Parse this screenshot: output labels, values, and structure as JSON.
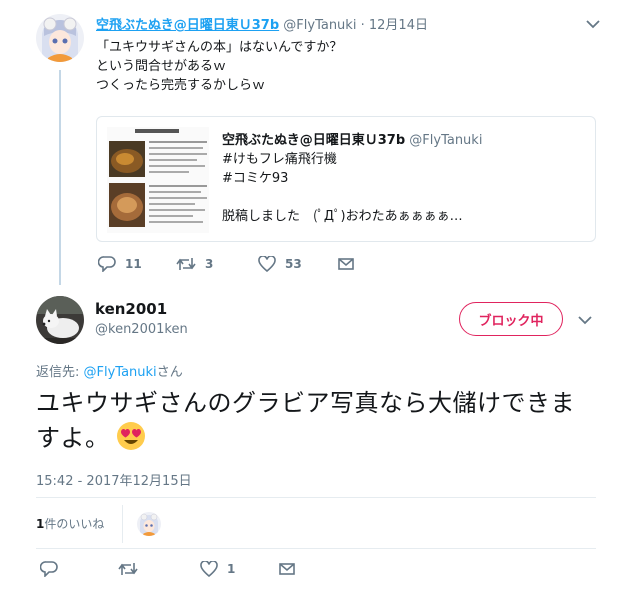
{
  "parent_tweet": {
    "name": "空飛ぶたぬき@日曜日東Ｕ37b",
    "handle": "@FlyTanuki",
    "separator": "·",
    "time": "12月14日",
    "lines": [
      "「ユキウサギさんの本」はないんですか？",
      "という問合せがあるｗ",
      "つくったら完売するかしらｗ"
    ],
    "quote": {
      "name": "空飛ぶたぬき@日曜日東Ｕ37b",
      "handle": "@FlyTanuki",
      "lines": [
        "#けもフレ痛飛行機",
        "#コミケ93",
        "",
        "脱稿しました　(ﾟДﾟ)おわたあぁぁぁぁ…"
      ]
    },
    "actions": {
      "replies": "11",
      "retweets": "3",
      "likes": "53"
    }
  },
  "main_tweet": {
    "name": "ken2001",
    "handle": "@ken2001ken",
    "block_label": "ブロック中",
    "reply_prefix": "返信先: ",
    "reply_user": "@FlyTanuki",
    "reply_suffix": "さん",
    "text": "ユキウサギさんのグラビア写真なら大儲けできますよ。",
    "emoji": "heart-eyes-emoji",
    "timestamp": "15:42 - 2017年12月15日",
    "likes_count": "1",
    "likes_label": "件のいいね",
    "actions": {
      "replies": "",
      "retweets": "",
      "likes": "1"
    }
  },
  "colors": {
    "link": "#1da1f2",
    "block": "#e0245e",
    "muted": "#657786",
    "thread": "#c4d7e6"
  }
}
